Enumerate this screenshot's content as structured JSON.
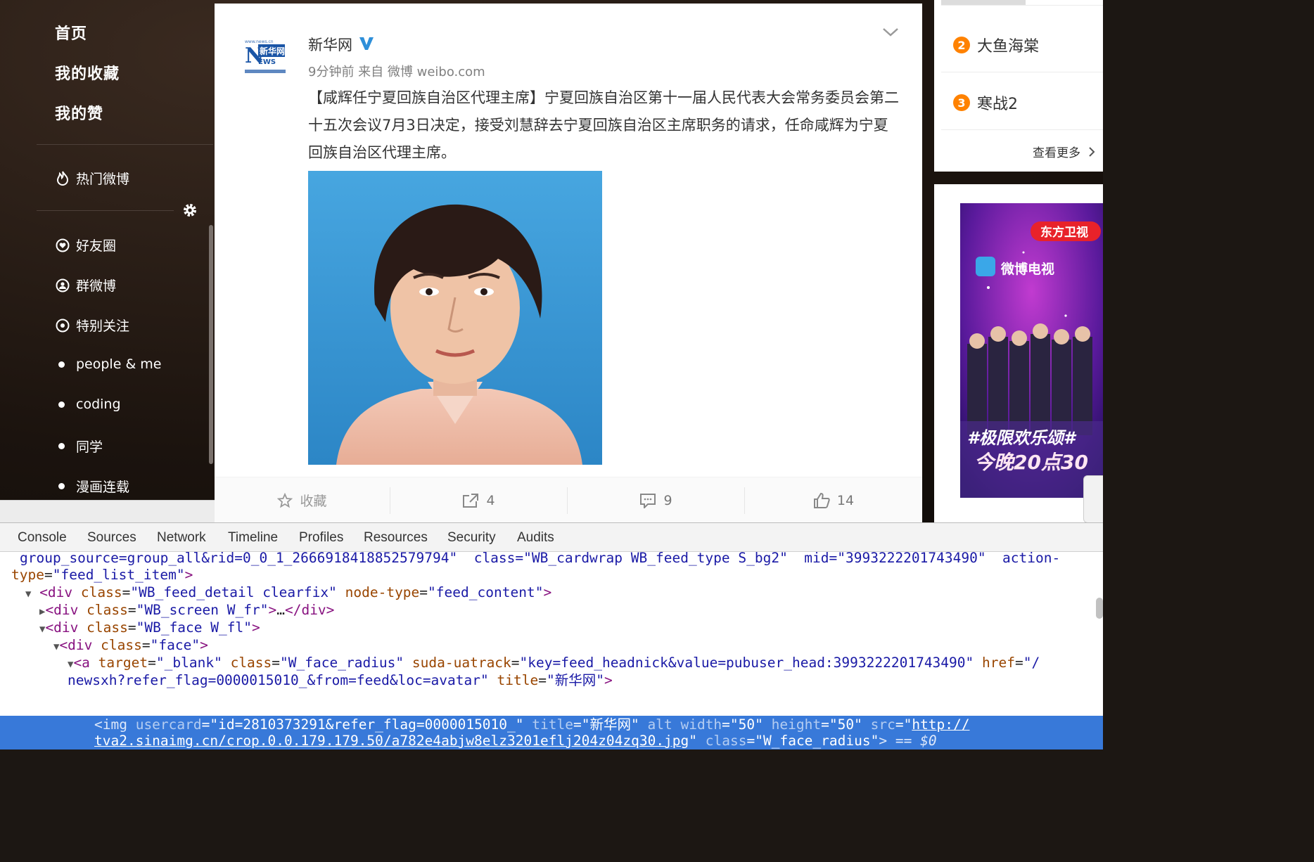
{
  "nav": {
    "main": [
      "首页",
      "我的收藏",
      "我的赞"
    ],
    "hot": "热门微博",
    "groups": [
      {
        "label": "好友圈",
        "icon": "heart-circle-icon"
      },
      {
        "label": "群微博",
        "icon": "user-circle-icon"
      },
      {
        "label": "特别关注",
        "icon": "eye-circle-icon"
      },
      {
        "label": "people & me",
        "icon": "dot-icon"
      },
      {
        "label": "coding",
        "icon": "dot-icon"
      },
      {
        "label": "同学",
        "icon": "dot-icon"
      },
      {
        "label": "漫画连载",
        "icon": "dot-icon"
      }
    ]
  },
  "post": {
    "author": "新华网",
    "meta": "9分钟前 来自 微博 weibo.com",
    "text": "【咸辉任宁夏回族自治区代理主席】宁夏回族自治区第十一届人民代表大会常务委员会第二十五次会议7月3日决定，接受刘慧辞去宁夏回族自治区主席职务的请求，任命咸辉为宁夏回族自治区代理主席。",
    "actions": {
      "favorite": "收藏",
      "repost": "4",
      "comment": "9",
      "like": "14"
    }
  },
  "right": {
    "hot_list": [
      {
        "rank": "2",
        "title": "大鱼海棠"
      },
      {
        "rank": "3",
        "title": "寒战2"
      }
    ],
    "more": "查看更多",
    "ad": {
      "channel": "东方卫视",
      "brand": "微博电视",
      "tag": "#极限欢乐颂#",
      "time": "今晚20点30"
    }
  },
  "devtools": {
    "tabs": [
      "Console",
      "Sources",
      "Network",
      "Timeline",
      "Profiles",
      "Resources",
      "Security",
      "Audits"
    ],
    "lines": {
      "l0_attr": "group_source=group_all&rid=0_0_1_2666918418852579794\"  class=\"WB_cardwrap WB_feed_type S_bg2\"  mid=\"3993222201743490\"  action-",
      "l1_name": "type",
      "l1_value": "feed_list_item",
      "l2_class": "WB_feed_detail clearfix",
      "l2_nodetype": "feed_content",
      "l3_class": "WB_screen W_fr",
      "l4_class": "WB_face W_fl",
      "l5_class": "face",
      "l6_target": "_blank",
      "l6_class": "W_face_radius",
      "l6_suda": "key=feed_headnick&value=pubuser_head:3993222201743490",
      "l6_href": "/",
      "l7_href_cont": "newsxh?refer_flag=0000015010_&from=feed&loc=avatar",
      "l7_title": "新华网",
      "l8_usercard": "id=2810373291&refer_flag=0000015010_",
      "l8_title": "新华网",
      "l8_width": "50",
      "l8_height": "50",
      "l8_src": "http://",
      "l9_src_cont": "tva2.sinaimg.cn/crop.0.0.179.179.50/a782e4abjw8elz3201eflj204z04zq30.jpg",
      "l9_class": "W_face_radius",
      "l9_eq": "== $0"
    }
  }
}
